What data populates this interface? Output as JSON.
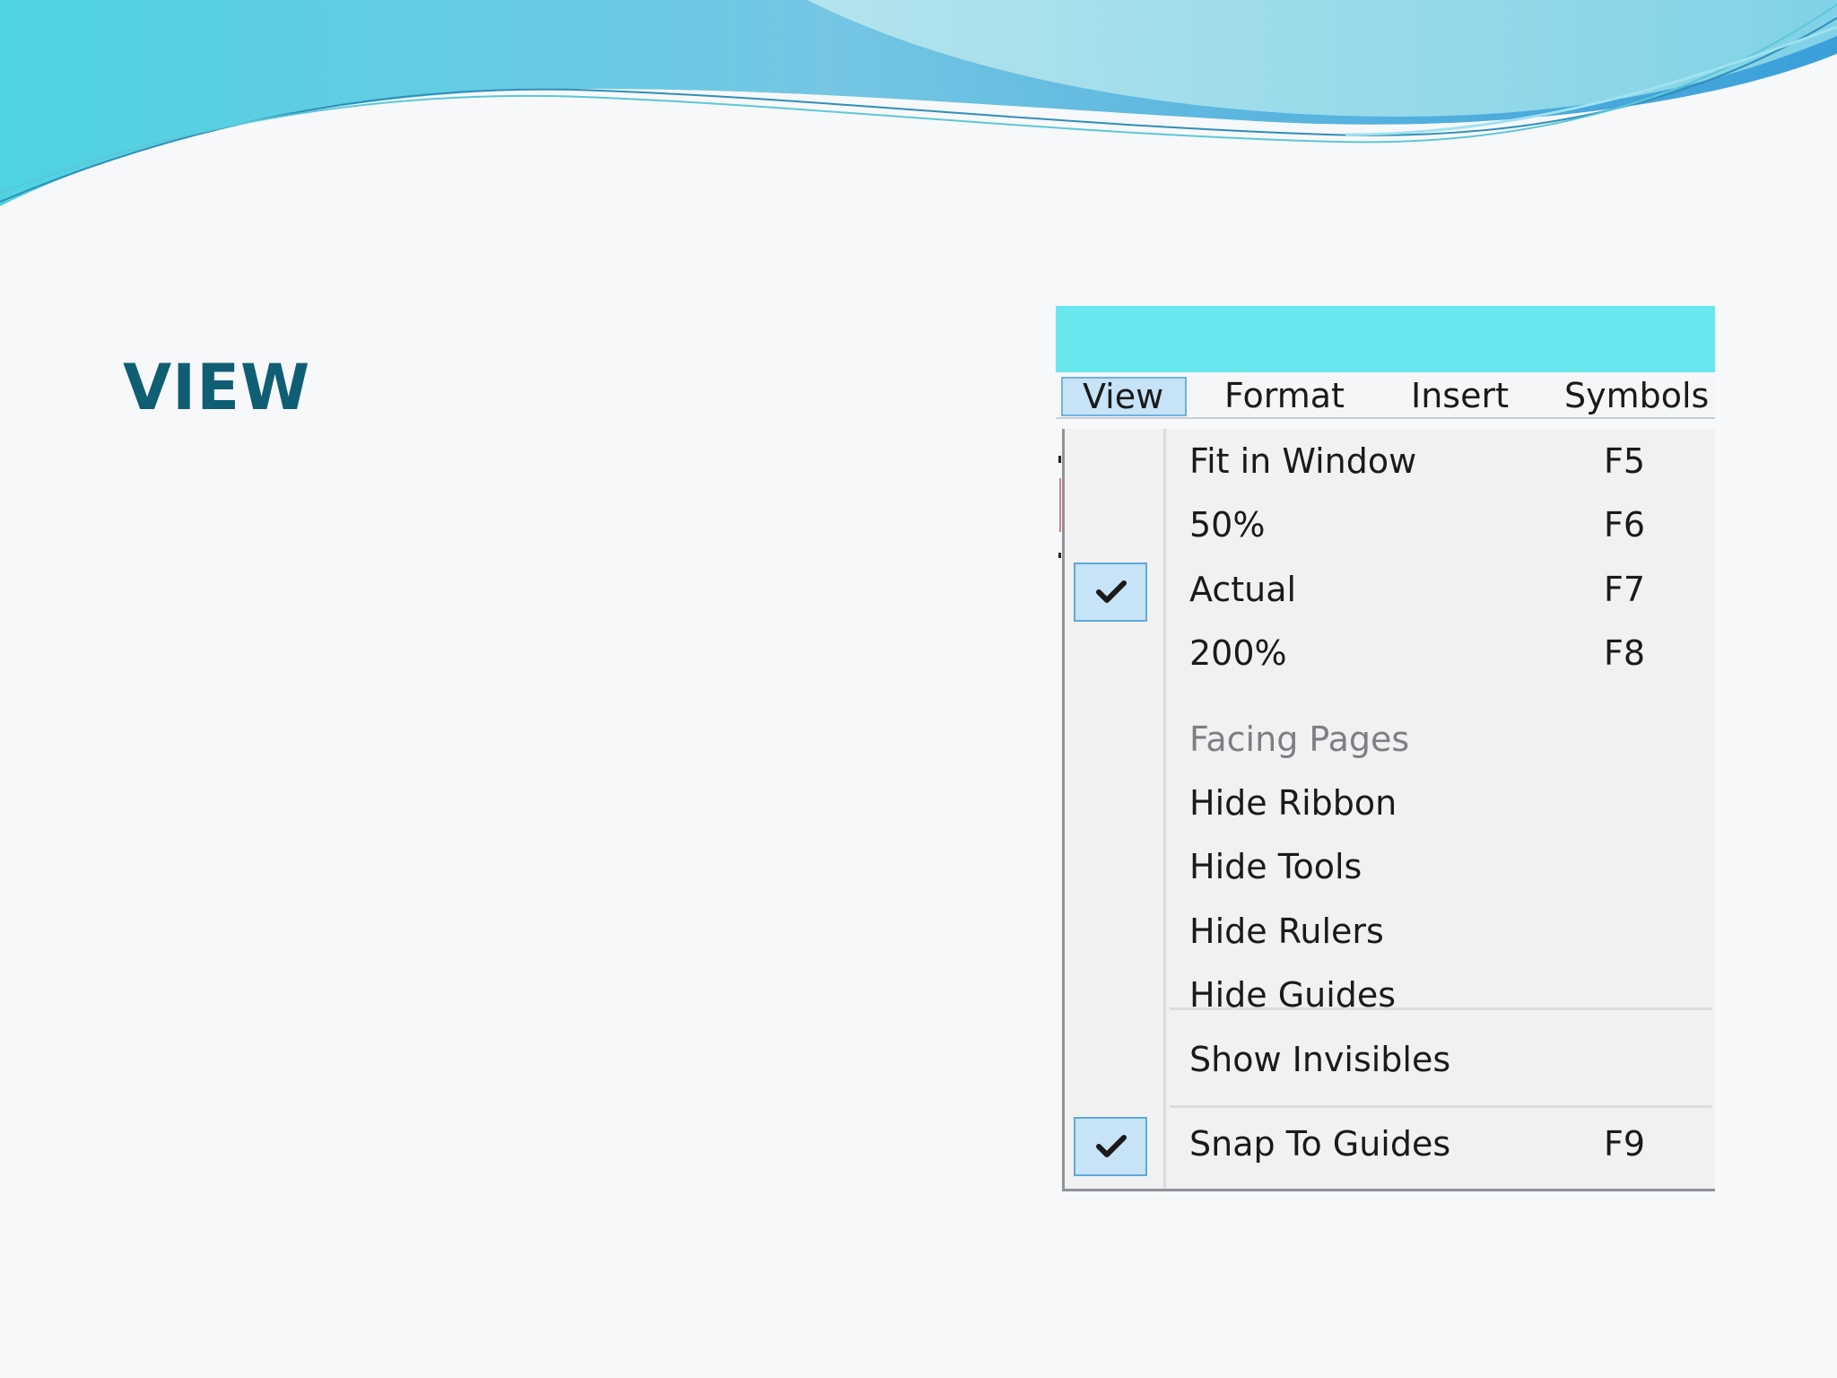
{
  "slide": {
    "title": "VIEW"
  },
  "window": {
    "menubar": [
      "View",
      "Format",
      "Insert",
      "Symbols"
    ],
    "active_menu": "View"
  },
  "view_menu": {
    "items": [
      {
        "label": "Fit in Window",
        "shortcut": "F5",
        "checked": false,
        "enabled": true
      },
      {
        "label": "50%",
        "shortcut": "F6",
        "checked": false,
        "enabled": true
      },
      {
        "label": "Actual",
        "shortcut": "F7",
        "checked": true,
        "enabled": true
      },
      {
        "label": "200%",
        "shortcut": "F8",
        "checked": false,
        "enabled": true
      },
      {
        "label": "Facing Pages",
        "shortcut": "",
        "checked": false,
        "enabled": false
      },
      {
        "label": "Hide Ribbon",
        "shortcut": "",
        "checked": false,
        "enabled": true
      },
      {
        "label": "Hide Tools",
        "shortcut": "",
        "checked": false,
        "enabled": true
      },
      {
        "label": "Hide Rulers",
        "shortcut": "",
        "checked": false,
        "enabled": true
      },
      {
        "label": "Hide Guides",
        "shortcut": "",
        "checked": false,
        "enabled": true
      },
      {
        "label": "Show Invisibles",
        "shortcut": "",
        "checked": false,
        "enabled": true
      },
      {
        "label": "Snap To Guides",
        "shortcut": "F9",
        "checked": true,
        "enabled": true
      }
    ],
    "check_icon": "checkmark-icon"
  },
  "colors": {
    "title_text": "#0f5e74",
    "titlebar": "#68e8ee",
    "highlight_fill": "#c6e3f7",
    "highlight_border": "#5da8dc",
    "menu_bg": "#f1f1f2",
    "disabled_text": "#7c7f83"
  }
}
